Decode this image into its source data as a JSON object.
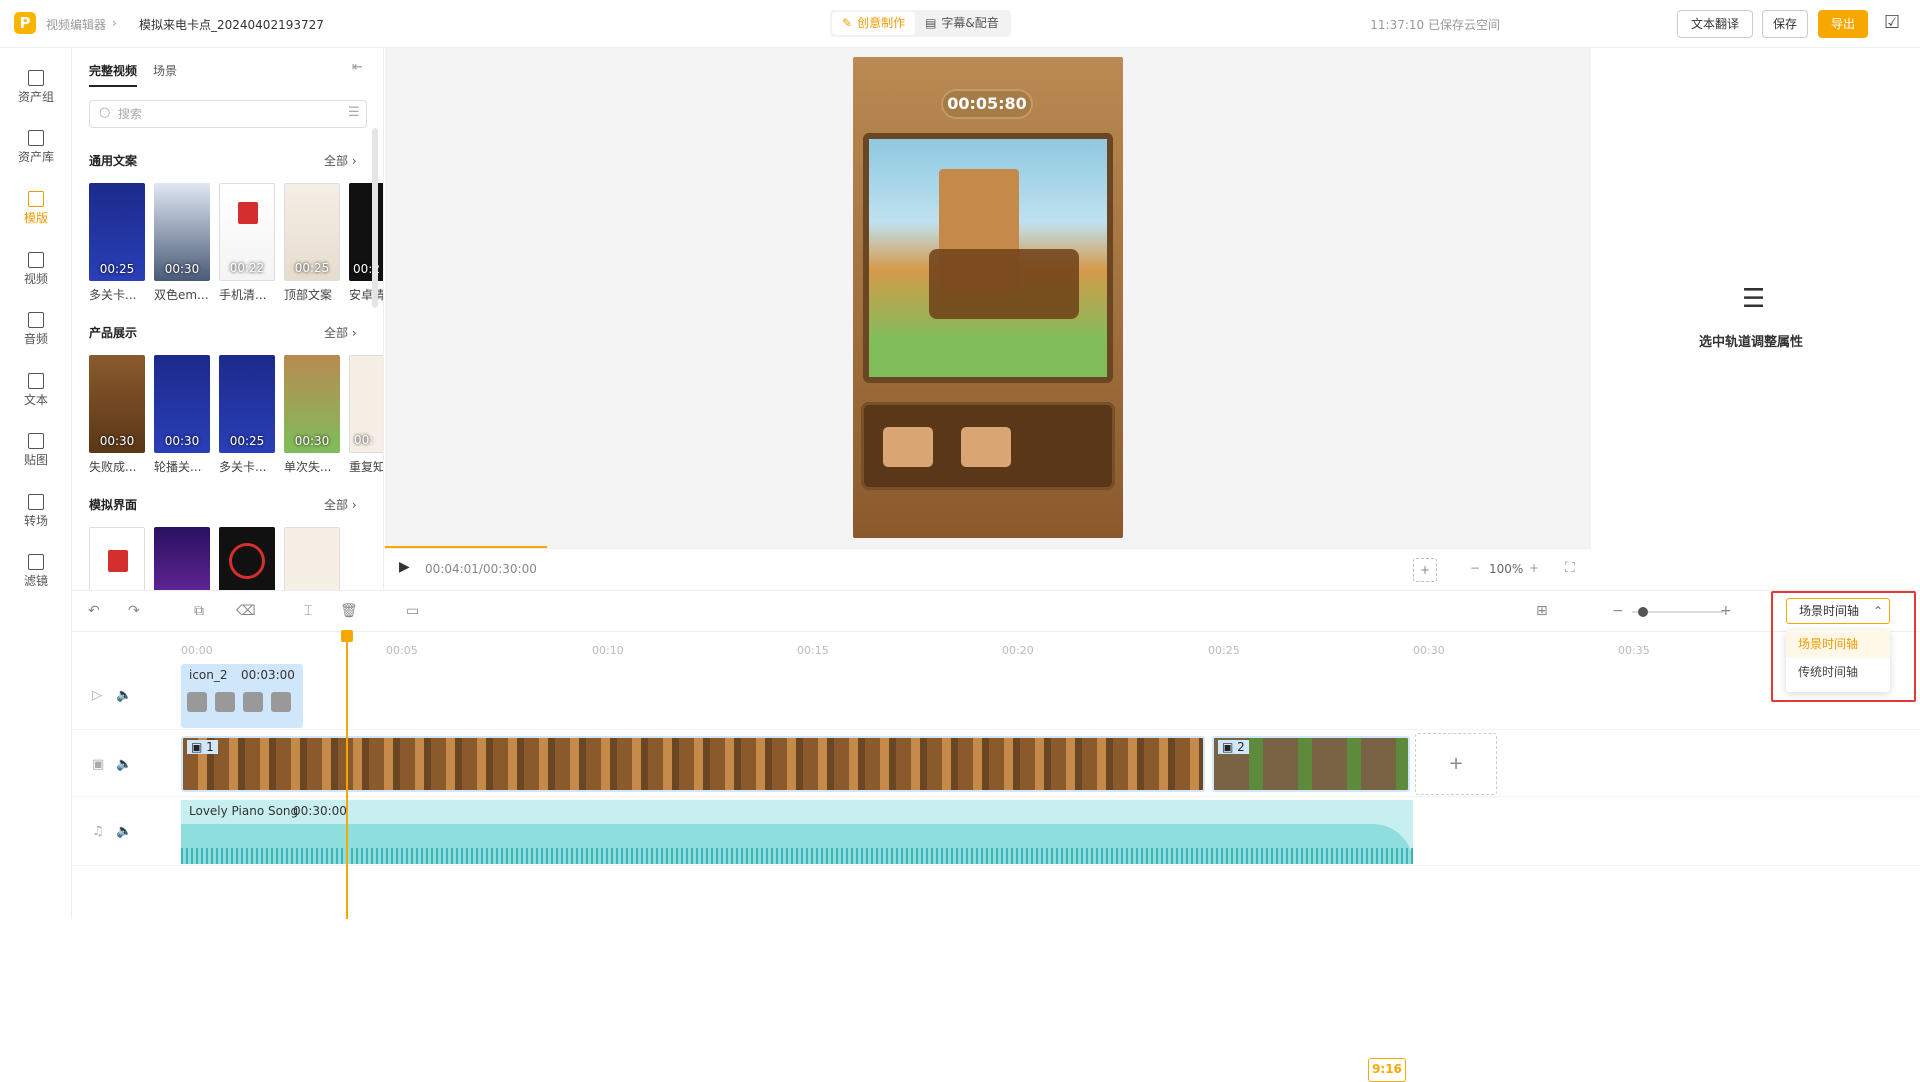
{
  "header": {
    "breadcrumb_root": "视频编辑器",
    "project_name": "模拟来电卡点_20240402193727",
    "mode_tabs": [
      "创意制作",
      "字幕&配音"
    ],
    "active_mode": "创意制作",
    "save_state": "11:37:10 已保存云空间",
    "translate_label": "文本翻译",
    "save_label": "保存",
    "export_label": "导出"
  },
  "nav": {
    "items": [
      "资产组",
      "资产库",
      "模版",
      "视频",
      "音频",
      "文本",
      "贴图",
      "转场",
      "滤镜"
    ],
    "active": "模版"
  },
  "panel": {
    "tabs": [
      "完整视频",
      "场景"
    ],
    "search_placeholder": "搜索",
    "sections": [
      {
        "title": "通用文案",
        "all": "全部",
        "items": [
          {
            "dur": "00:25",
            "label": "多关卡..."
          },
          {
            "dur": "00:30",
            "label": "双色em..."
          },
          {
            "dur": "00:22",
            "label": "手机清..."
          },
          {
            "dur": "00:25",
            "label": "顶部文案"
          },
          {
            "dur": "00:2",
            "label": "安卓清"
          }
        ]
      },
      {
        "title": "产品展示",
        "all": "全部",
        "items": [
          {
            "dur": "00:30",
            "label": "失败成..."
          },
          {
            "dur": "00:30",
            "label": "轮播关..."
          },
          {
            "dur": "00:25",
            "label": "多关卡..."
          },
          {
            "dur": "00:30",
            "label": "单次失..."
          },
          {
            "dur": "00:",
            "label": "重复知"
          }
        ]
      },
      {
        "title": "模拟界面",
        "all": "全部",
        "items": [
          {
            "dur": "",
            "label": ""
          },
          {
            "dur": "",
            "label": ""
          },
          {
            "dur": "",
            "label": ""
          },
          {
            "dur": "",
            "label": ""
          }
        ]
      }
    ]
  },
  "preview": {
    "game_timer": "00:05:80",
    "current_time": "00:04:01/00:30:00",
    "ratio": "9:16",
    "zoom": "100%",
    "progress": 0.134
  },
  "props": {
    "hint": "选中轨道调整属性"
  },
  "timeline": {
    "ticks": [
      "00:00",
      "00:05",
      "00:10",
      "00:15",
      "00:20",
      "00:25",
      "00:30",
      "00:35"
    ],
    "mode_dropdown": "场景时间轴",
    "mode_options": [
      "场景时间轴",
      "传统时间轴"
    ],
    "selected_mode": "场景时间轴",
    "icon_clip": {
      "name": "icon_2",
      "duration": "00:03:00"
    },
    "video_clips": [
      {
        "index": "1"
      },
      {
        "index": "2"
      }
    ],
    "audio_clip": {
      "name": "Lovely Piano Song",
      "duration": "00:30:00"
    },
    "playhead_time": "00:04:01"
  },
  "colors": {
    "accent": "#f7a800",
    "highlight_box": "#e53935"
  }
}
